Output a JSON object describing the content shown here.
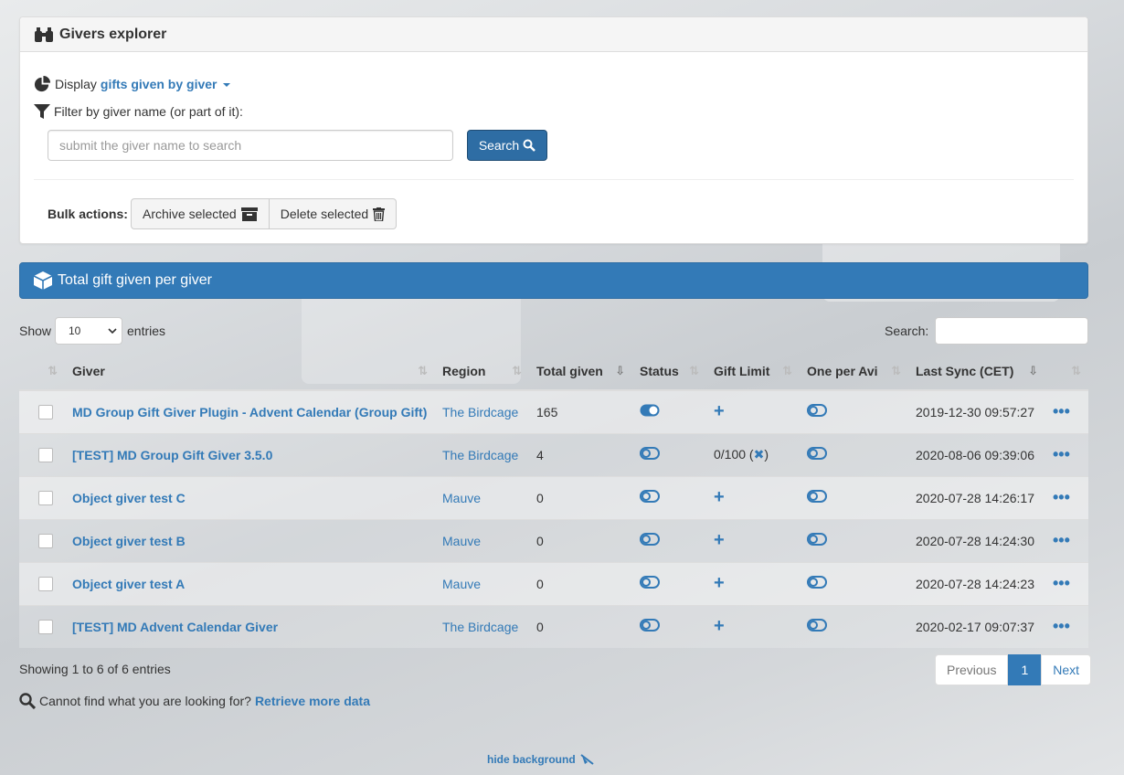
{
  "explorer": {
    "title": "Givers explorer",
    "display_prefix": "Display",
    "display_value": "gifts given by giver",
    "filter_label": "Filter by giver name (or part of it):",
    "search_placeholder": "submit the giver name to search",
    "search_button": "Search",
    "bulk_label": "Bulk actions:",
    "archive_label": "Archive selected",
    "delete_label": "Delete selected"
  },
  "summary": {
    "title": "Total gift given per giver"
  },
  "table_controls": {
    "show_label": "Show",
    "page_size": "10",
    "entries_label": "entries",
    "search_label": "Search:"
  },
  "columns": [
    "Giver",
    "Region",
    "Total given",
    "Status",
    "Gift Limit",
    "One per Avi",
    "Last Sync (CET)"
  ],
  "rows": [
    {
      "giver": "MD Group Gift Giver Plugin - Advent Calendar (Group Gift)",
      "region": "The Birdcage",
      "total": "165",
      "status": "on",
      "limit": "+",
      "sync": "2019-12-30 09:57:27"
    },
    {
      "giver": "[TEST] MD Group Gift Giver 3.5.0",
      "region": "The Birdcage",
      "total": "4",
      "status": "off",
      "limit": "0/100",
      "sync": "2020-08-06 09:39:06"
    },
    {
      "giver": "Object giver test C",
      "region": "Mauve",
      "total": "0",
      "status": "off",
      "limit": "+",
      "sync": "2020-07-28 14:26:17"
    },
    {
      "giver": "Object giver test B",
      "region": "Mauve",
      "total": "0",
      "status": "off",
      "limit": "+",
      "sync": "2020-07-28 14:24:30"
    },
    {
      "giver": "Object giver test A",
      "region": "Mauve",
      "total": "0",
      "status": "off",
      "limit": "+",
      "sync": "2020-07-28 14:24:23"
    },
    {
      "giver": "[TEST] MD Advent Calendar Giver",
      "region": "The Birdcage",
      "total": "0",
      "status": "off",
      "limit": "+",
      "sync": "2020-02-17 09:07:37"
    }
  ],
  "footer": {
    "info": "Showing 1 to 6 of 6 entries",
    "prev": "Previous",
    "page": "1",
    "next": "Next",
    "cannot_find": "Cannot find what you are looking for?",
    "retrieve": "Retrieve more data",
    "hide_bg": "hide background"
  },
  "colors": {
    "primary": "#337ab7",
    "primary_dark": "#2e6da4"
  }
}
